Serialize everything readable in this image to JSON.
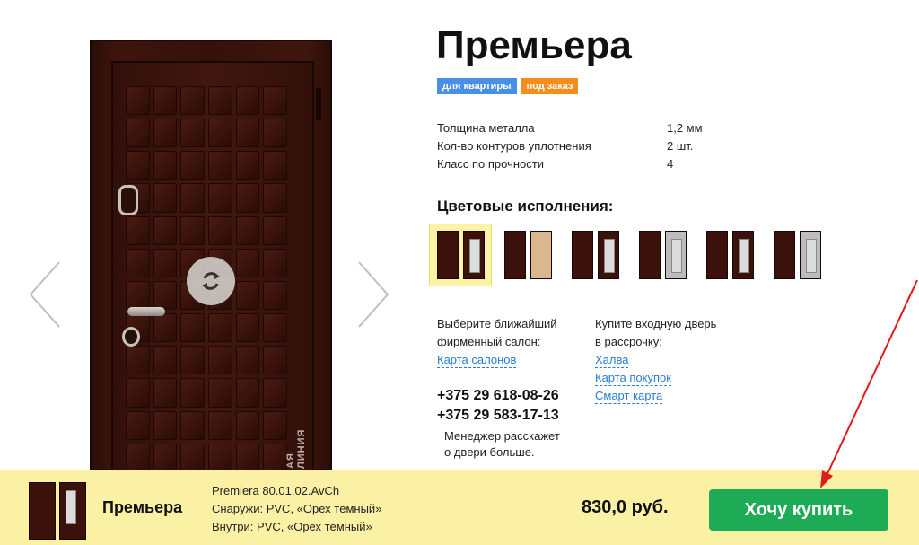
{
  "product": {
    "title": "Премьера",
    "badges": [
      "для квартиры",
      "под заказ"
    ],
    "brand_watermark": "АЯ ЛИНИЯ",
    "specs": [
      {
        "name": "Толщина металла",
        "value": "1,2 мм"
      },
      {
        "name": "Кол-во контуров уплотнения",
        "value": "2 шт."
      },
      {
        "name": "Класс по прочности",
        "value": "4"
      }
    ],
    "colors_title": "Цветовые исполнения:"
  },
  "salon": {
    "text_line1": "Выберите ближайший",
    "text_line2": "фирменный салон:",
    "link": "Карта салонов"
  },
  "credit": {
    "text_line1": "Купите входную дверь",
    "text_line2": "в рассрочку:",
    "links": [
      "Халва",
      "Карта покупок",
      "Смарт карта"
    ]
  },
  "phones": [
    "+375 29 618-08-26",
    "+375 29 583-17-13"
  ],
  "manager": {
    "line1": "Менеджер расскажет",
    "line2": "о двери больше."
  },
  "bar": {
    "title": "Премьера",
    "model": "Premiera 80.01.02.AvCh",
    "outside": "Снаружи: PVC, «Орех тёмный»",
    "inside": "Внутри: PVC, «Орех тёмный»",
    "price": "830,0 руб.",
    "buy_label": "Хочу купить"
  },
  "colors": {
    "accent_green": "#1dac55",
    "badge_blue": "#4a8fe6",
    "badge_orange": "#f38d1d",
    "bar_yellow": "#fbf1a4",
    "link_blue": "#2b7bd0"
  }
}
